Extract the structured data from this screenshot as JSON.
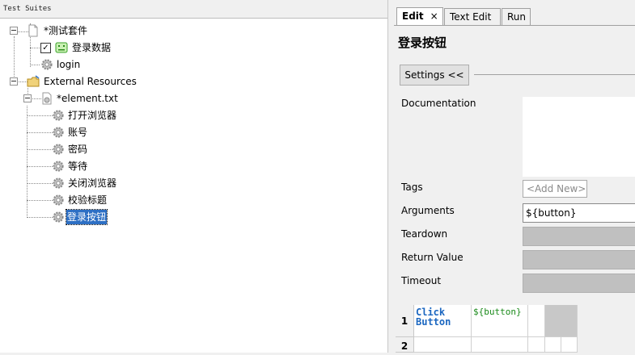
{
  "left_panel": {
    "header": "Test Suites",
    "tree": {
      "suite": "*测试套件",
      "testcase": "登录数据",
      "testcase_checked": "✓",
      "keyword_login": "login",
      "external": "External Resources",
      "resource_file": "*element.txt",
      "keywords": [
        "打开浏览器",
        "账号",
        "密码",
        "等待",
        "关闭浏览器",
        "校验标题",
        "登录按钮"
      ]
    }
  },
  "right_panel": {
    "tabs": [
      {
        "label": "Edit",
        "active": true
      },
      {
        "label": "Text Edit",
        "active": false
      },
      {
        "label": "Run",
        "active": false
      }
    ],
    "close_glyph": "×",
    "keyword_title": "登录按钮",
    "settings_button": "Settings <<",
    "fields": {
      "documentation": "Documentation",
      "tags": "Tags",
      "tags_add": "<Add New>",
      "arguments": "Arguments",
      "arguments_value": "${button}",
      "teardown": "Teardown",
      "return_value": "Return Value",
      "timeout": "Timeout"
    },
    "grid": {
      "rows": [
        {
          "num": "1",
          "keyword": "Click\nButton",
          "arg": "${button}"
        },
        {
          "num": "2",
          "keyword": "",
          "arg": ""
        }
      ]
    }
  },
  "colors": {
    "selection": "#2d6fc4",
    "keyword_blue": "#1a66c0",
    "argument_green": "#1a8a1a"
  },
  "icons": {
    "toggle": "minus-box-icon",
    "gear": "gear-icon",
    "file": "file-icon",
    "folder": "folder-icon",
    "testcase": "robot-icon"
  }
}
